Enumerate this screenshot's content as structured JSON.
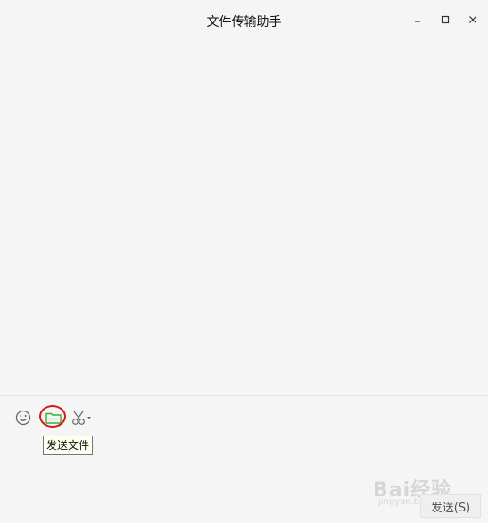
{
  "window": {
    "title": "文件传输助手"
  },
  "toolbar": {
    "emoji_icon": "smiley-face-icon",
    "file_icon": "folder-icon",
    "screenshot_icon": "scissors-icon",
    "highlight_color": "#d61818"
  },
  "tooltip": {
    "text": "发送文件"
  },
  "send_button": {
    "label": "发送(S)"
  },
  "watermark": {
    "brand": "Bai经验",
    "url": "jingyan.baidu.com"
  },
  "colors": {
    "background": "#f5f5f5",
    "file_icon_green": "#3aab3a",
    "tooltip_bg": "#fffff0"
  }
}
